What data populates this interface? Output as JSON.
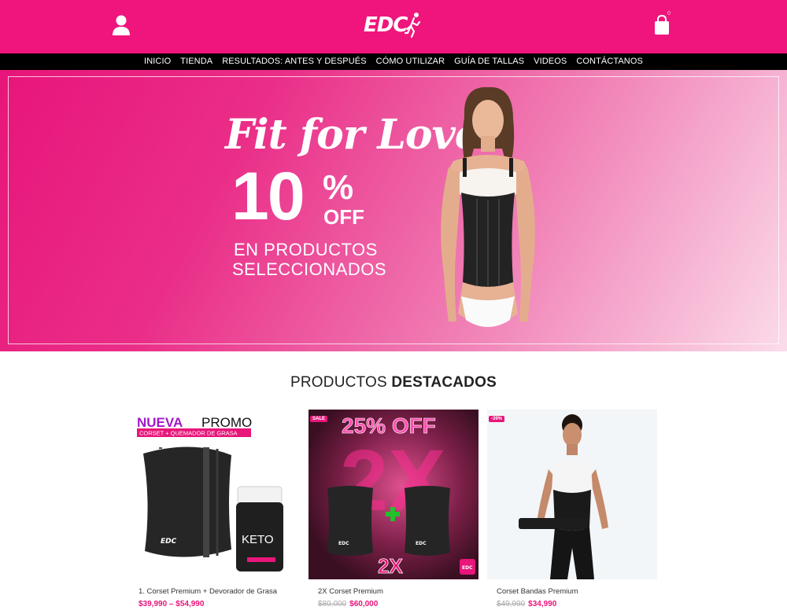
{
  "header": {
    "logo_text": "EDC",
    "cart_count": "0"
  },
  "nav": {
    "items": [
      "INICIO",
      "TIENDA",
      "RESULTADOS: ANTES Y DESPUÉS",
      "CÓMO UTILIZAR",
      "GUÍA DE TALLAS",
      "VIDEOS",
      "CONTÁCTANOS"
    ]
  },
  "hero": {
    "script_line": "Fit for Love",
    "percent_value": "10",
    "percent_sign": "%",
    "off_label": "OFF",
    "line1": "EN PRODUCTOS",
    "line2": "SELECCIONADOS"
  },
  "section": {
    "title_light": "PRODUCTOS",
    "title_bold": "DESTACADOS"
  },
  "products": [
    {
      "promo_title_a": "NUEVA",
      "promo_title_b": "PROMO",
      "promo_subtitle": "CORSET + QUEMADOR DE GRASA",
      "jar_label": "KETO",
      "name": "1. Corset Premium + Devorador de Grasa",
      "price": "$39,990 – $54,990"
    },
    {
      "badge": "SALE",
      "promo_title": "25% OFF",
      "big_text": "2X",
      "qty_text": "2X",
      "name": "2X Corset Premium",
      "old_price": "$80,000",
      "price": "$60,000"
    },
    {
      "badge": "-39%",
      "name": "Corset Bandas Premium",
      "old_price": "$49,990",
      "price": "$34,990"
    }
  ],
  "colors": {
    "brand_pink": "#f0157c",
    "nav_bg": "#000000",
    "price_pink": "#e8157a"
  }
}
